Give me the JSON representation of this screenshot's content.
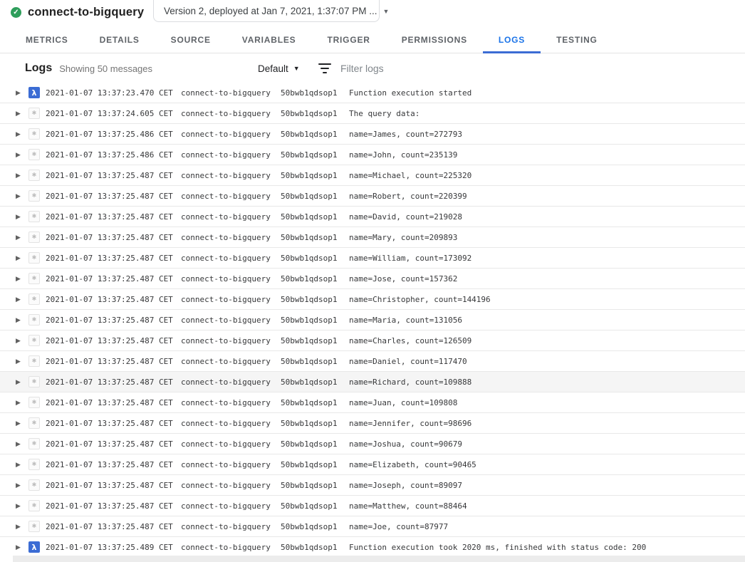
{
  "header": {
    "title": "connect-to-bigquery",
    "status_icon": "check-circle",
    "version_selector": {
      "label": "Version 2, deployed at Jan 7, 2021, 1:37:07 PM ..."
    }
  },
  "tabs": [
    {
      "label": "METRICS",
      "active": false
    },
    {
      "label": "DETAILS",
      "active": false
    },
    {
      "label": "SOURCE",
      "active": false
    },
    {
      "label": "VARIABLES",
      "active": false
    },
    {
      "label": "TRIGGER",
      "active": false
    },
    {
      "label": "PERMISSIONS",
      "active": false
    },
    {
      "label": "LOGS",
      "active": true
    },
    {
      "label": "TESTING",
      "active": false
    }
  ],
  "logs_toolbar": {
    "title": "Logs",
    "message_count": "Showing 50 messages",
    "severity_filter": "Default",
    "filter_placeholder": "Filter logs"
  },
  "icons": {
    "check": "✓",
    "dropdown_arrow": "▼",
    "caret": "▶",
    "lambda": "λ",
    "info": "✱",
    "filter": "filter-list"
  },
  "colors": {
    "accent_blue": "#1a73e8",
    "tab_underline": "#3b6cd4",
    "lambda_badge_bg": "#3b6cd4",
    "status_green": "#2e9e5b",
    "row_highlight_bg": "#f5f5f5"
  },
  "log_rows": [
    {
      "severity": "lambda",
      "timestamp": "2021-01-07 13:37:23.470 CET",
      "source": "connect-to-bigquery",
      "execution_id": "50bwb1qdsop1",
      "message": "Function execution started",
      "highlighted": false
    },
    {
      "severity": "info",
      "timestamp": "2021-01-07 13:37:24.605 CET",
      "source": "connect-to-bigquery",
      "execution_id": "50bwb1qdsop1",
      "message": "The query data:",
      "highlighted": false
    },
    {
      "severity": "info",
      "timestamp": "2021-01-07 13:37:25.486 CET",
      "source": "connect-to-bigquery",
      "execution_id": "50bwb1qdsop1",
      "message": "name=James, count=272793",
      "highlighted": false
    },
    {
      "severity": "info",
      "timestamp": "2021-01-07 13:37:25.486 CET",
      "source": "connect-to-bigquery",
      "execution_id": "50bwb1qdsop1",
      "message": "name=John, count=235139",
      "highlighted": false
    },
    {
      "severity": "info",
      "timestamp": "2021-01-07 13:37:25.487 CET",
      "source": "connect-to-bigquery",
      "execution_id": "50bwb1qdsop1",
      "message": "name=Michael, count=225320",
      "highlighted": false
    },
    {
      "severity": "info",
      "timestamp": "2021-01-07 13:37:25.487 CET",
      "source": "connect-to-bigquery",
      "execution_id": "50bwb1qdsop1",
      "message": "name=Robert, count=220399",
      "highlighted": false
    },
    {
      "severity": "info",
      "timestamp": "2021-01-07 13:37:25.487 CET",
      "source": "connect-to-bigquery",
      "execution_id": "50bwb1qdsop1",
      "message": "name=David, count=219028",
      "highlighted": false
    },
    {
      "severity": "info",
      "timestamp": "2021-01-07 13:37:25.487 CET",
      "source": "connect-to-bigquery",
      "execution_id": "50bwb1qdsop1",
      "message": "name=Mary, count=209893",
      "highlighted": false
    },
    {
      "severity": "info",
      "timestamp": "2021-01-07 13:37:25.487 CET",
      "source": "connect-to-bigquery",
      "execution_id": "50bwb1qdsop1",
      "message": "name=William, count=173092",
      "highlighted": false
    },
    {
      "severity": "info",
      "timestamp": "2021-01-07 13:37:25.487 CET",
      "source": "connect-to-bigquery",
      "execution_id": "50bwb1qdsop1",
      "message": "name=Jose, count=157362",
      "highlighted": false
    },
    {
      "severity": "info",
      "timestamp": "2021-01-07 13:37:25.487 CET",
      "source": "connect-to-bigquery",
      "execution_id": "50bwb1qdsop1",
      "message": "name=Christopher, count=144196",
      "highlighted": false
    },
    {
      "severity": "info",
      "timestamp": "2021-01-07 13:37:25.487 CET",
      "source": "connect-to-bigquery",
      "execution_id": "50bwb1qdsop1",
      "message": "name=Maria, count=131056",
      "highlighted": false
    },
    {
      "severity": "info",
      "timestamp": "2021-01-07 13:37:25.487 CET",
      "source": "connect-to-bigquery",
      "execution_id": "50bwb1qdsop1",
      "message": "name=Charles, count=126509",
      "highlighted": false
    },
    {
      "severity": "info",
      "timestamp": "2021-01-07 13:37:25.487 CET",
      "source": "connect-to-bigquery",
      "execution_id": "50bwb1qdsop1",
      "message": "name=Daniel, count=117470",
      "highlighted": false
    },
    {
      "severity": "info",
      "timestamp": "2021-01-07 13:37:25.487 CET",
      "source": "connect-to-bigquery",
      "execution_id": "50bwb1qdsop1",
      "message": "name=Richard, count=109888",
      "highlighted": true
    },
    {
      "severity": "info",
      "timestamp": "2021-01-07 13:37:25.487 CET",
      "source": "connect-to-bigquery",
      "execution_id": "50bwb1qdsop1",
      "message": "name=Juan, count=109808",
      "highlighted": false
    },
    {
      "severity": "info",
      "timestamp": "2021-01-07 13:37:25.487 CET",
      "source": "connect-to-bigquery",
      "execution_id": "50bwb1qdsop1",
      "message": "name=Jennifer, count=98696",
      "highlighted": false
    },
    {
      "severity": "info",
      "timestamp": "2021-01-07 13:37:25.487 CET",
      "source": "connect-to-bigquery",
      "execution_id": "50bwb1qdsop1",
      "message": "name=Joshua, count=90679",
      "highlighted": false
    },
    {
      "severity": "info",
      "timestamp": "2021-01-07 13:37:25.487 CET",
      "source": "connect-to-bigquery",
      "execution_id": "50bwb1qdsop1",
      "message": "name=Elizabeth, count=90465",
      "highlighted": false
    },
    {
      "severity": "info",
      "timestamp": "2021-01-07 13:37:25.487 CET",
      "source": "connect-to-bigquery",
      "execution_id": "50bwb1qdsop1",
      "message": "name=Joseph, count=89097",
      "highlighted": false
    },
    {
      "severity": "info",
      "timestamp": "2021-01-07 13:37:25.487 CET",
      "source": "connect-to-bigquery",
      "execution_id": "50bwb1qdsop1",
      "message": "name=Matthew, count=88464",
      "highlighted": false
    },
    {
      "severity": "info",
      "timestamp": "2021-01-07 13:37:25.487 CET",
      "source": "connect-to-bigquery",
      "execution_id": "50bwb1qdsop1",
      "message": "name=Joe, count=87977",
      "highlighted": false
    },
    {
      "severity": "lambda",
      "timestamp": "2021-01-07 13:37:25.489 CET",
      "source": "connect-to-bigquery",
      "execution_id": "50bwb1qdsop1",
      "message": "Function execution took 2020 ms, finished with status code: 200",
      "highlighted": false
    }
  ]
}
